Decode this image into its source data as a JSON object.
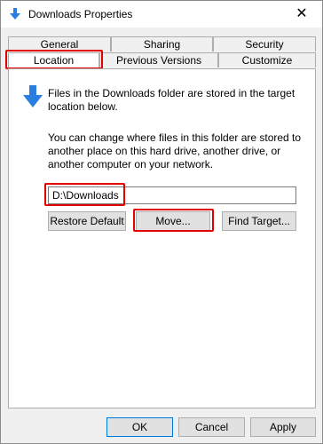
{
  "window": {
    "title": "Downloads Properties",
    "close_glyph": "✕"
  },
  "tabs_row1": [
    "General",
    "Sharing",
    "Security"
  ],
  "tabs_row2": [
    "Location",
    "Previous Versions",
    "Customize"
  ],
  "active_tab": "Location",
  "panel": {
    "description": "Files in the Downloads folder are stored in the target location below.",
    "instructions": "You can change where files in this folder are stored to another place on this hard drive, another drive, or another computer on your network.",
    "path_value": "D:\\Downloads",
    "buttons": {
      "restore": "Restore Default",
      "move": "Move...",
      "find": "Find Target..."
    }
  },
  "footer": {
    "ok": "OK",
    "cancel": "Cancel",
    "apply": "Apply"
  },
  "colors": {
    "accent": "#0078d7",
    "highlight": "#e30000"
  },
  "icons": {
    "title": "folder-download-arrow-icon",
    "panel": "download-arrow-icon"
  }
}
